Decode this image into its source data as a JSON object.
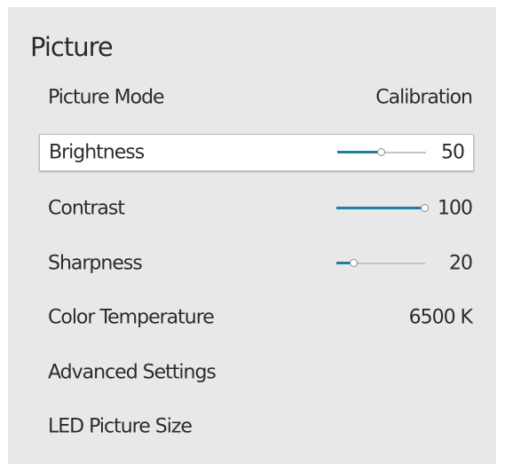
{
  "title": "Picture",
  "items": [
    {
      "label": "Picture Mode",
      "value": "Calibration"
    },
    {
      "label": "Brightness",
      "value": "50",
      "level": 0.5
    },
    {
      "label": "Contrast",
      "value": "100",
      "level": 1.0
    },
    {
      "label": "Sharpness",
      "value": "20",
      "level": 0.2
    },
    {
      "label": "Color Temperature",
      "value": "6500 K"
    },
    {
      "label": "Advanced Settings"
    },
    {
      "label": "LED Picture Size"
    }
  ],
  "colors": {
    "panel": "#e8e8e8",
    "accent": "#1e7fa0",
    "text": "#2b2b2b"
  }
}
